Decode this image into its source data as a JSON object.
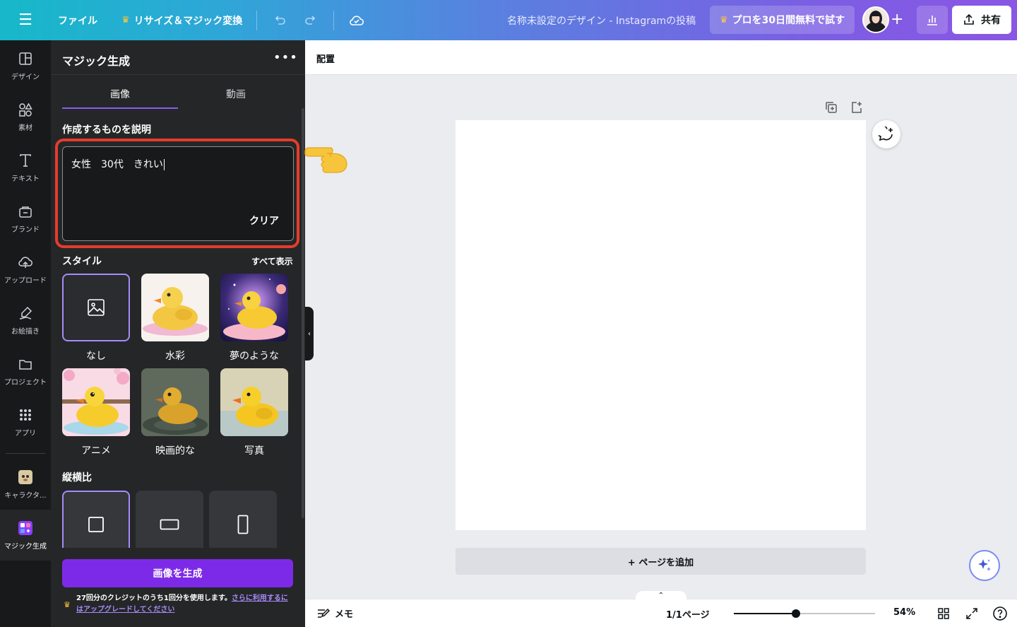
{
  "topbar": {
    "file": "ファイル",
    "resize": "リサイズ＆マジック変換",
    "doc_title": "名称未設定のデザイン - Instagramの投稿",
    "pro_trial": "プロを30日間無料で試す",
    "share": "共有"
  },
  "rail": {
    "items": [
      {
        "label": "デザイン"
      },
      {
        "label": "素材"
      },
      {
        "label": "テキスト"
      },
      {
        "label": "ブランド"
      },
      {
        "label": "アップロード"
      },
      {
        "label": "お絵描き"
      },
      {
        "label": "プロジェクト"
      },
      {
        "label": "アプリ"
      },
      {
        "label": "キャラクタ..."
      },
      {
        "label": "マジック生成"
      }
    ]
  },
  "panel": {
    "title": "マジック生成",
    "tabs": [
      "画像",
      "動画"
    ],
    "active_tab": "画像",
    "describe_label": "作成するものを説明",
    "prompt_value": "女性　30代　きれい",
    "clear": "クリア",
    "style_label": "スタイル",
    "see_all": "すべて表示",
    "styles": [
      {
        "label": "なし",
        "selected": true
      },
      {
        "label": "水彩"
      },
      {
        "label": "夢のような"
      },
      {
        "label": "アニメ"
      },
      {
        "label": "映画的な"
      },
      {
        "label": "写真"
      }
    ],
    "aspect_label": "縦横比",
    "generate": "画像を生成",
    "credit_text": "27回分のクレジットのうち1回分を使用します。",
    "credit_link": "さらに利用するにはアップグレードしてください"
  },
  "canvas": {
    "context_label": "配置",
    "add_page": "+ ページを追加"
  },
  "bottombar": {
    "memo": "メモ",
    "pages": "1/1ページ",
    "zoom": "54%",
    "zoom_value": 0.44
  },
  "colors": {
    "accent": "#7d2ae8",
    "highlight": "#e43c2d"
  }
}
